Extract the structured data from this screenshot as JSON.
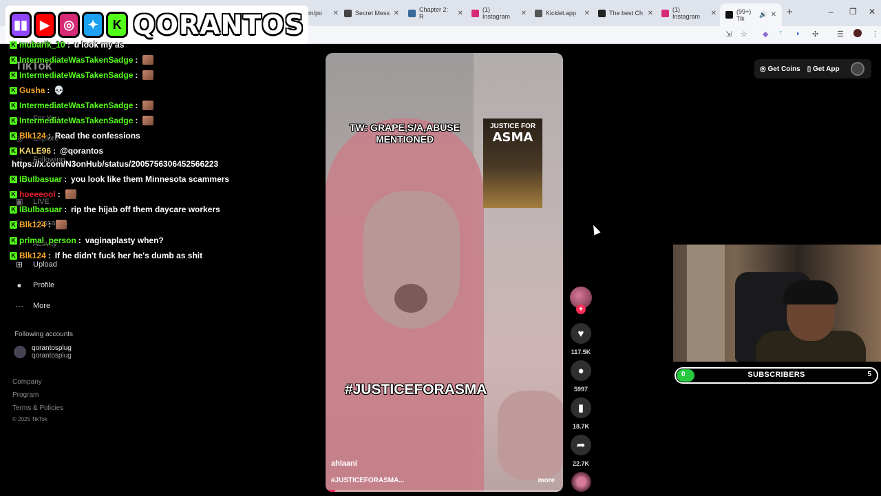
{
  "browser": {
    "tabs": [
      {
        "label": "m/po",
        "color": "#888888"
      },
      {
        "label": "Secret Mess",
        "color": "#444444"
      },
      {
        "label": "Chapter 2: R",
        "color": "#3a6b9a"
      },
      {
        "label": "(1) Instagram",
        "color": "#d62976"
      },
      {
        "label": "Kicklet.app",
        "color": "#555555"
      },
      {
        "label": "The best Ch",
        "color": "#222222"
      },
      {
        "label": "(1) Instagram",
        "color": "#d62976"
      },
      {
        "label": "(99+) Tik",
        "color": "#111111"
      }
    ],
    "new_tab": "+",
    "min": "–",
    "max": "❐",
    "close": "✕"
  },
  "banner": {
    "icons": [
      {
        "name": "twitch-icon",
        "glyph": "▮▮",
        "color": "#9146ff"
      },
      {
        "name": "youtube-icon",
        "glyph": "▶",
        "color": "#ff0000"
      },
      {
        "name": "instagram-icon",
        "glyph": "◎",
        "color": "#d62976"
      },
      {
        "name": "twitter-icon",
        "glyph": "✦",
        "color": "#1da1f2"
      },
      {
        "name": "kick-icon",
        "glyph": "K",
        "color": "#53fc18"
      }
    ],
    "channel_name": "QORANTOS"
  },
  "tiktok": {
    "logo": "TikTok",
    "nav": [
      {
        "icon": "⌂",
        "label": "For You"
      },
      {
        "icon": "◎",
        "label": "Explore"
      },
      {
        "icon": "☺",
        "label": "Following"
      },
      {
        "icon": "▣",
        "label": "LIVE"
      },
      {
        "icon": "▽",
        "label": "Messages"
      },
      {
        "icon": "◔",
        "label": "Activity"
      },
      {
        "icon": "+",
        "label": "Upload"
      },
      {
        "icon": "●",
        "label": "Profile"
      },
      {
        "icon": "···",
        "label": "More"
      }
    ],
    "following_header": "Following accounts",
    "following_account": {
      "display": "qorantosplug",
      "handle": "qorantosplug"
    },
    "footer": [
      "Company",
      "Program",
      "Terms & Policies",
      "© 2025 TikTok"
    ],
    "top_right": {
      "coins": "Get Coins",
      "app": "Get App"
    }
  },
  "chat": [
    {
      "user": "mubarik_10",
      "color": "#53fc18",
      "msg": "u look my as",
      "emote": false
    },
    {
      "user": "IntermediateWasTakenSadge",
      "color": "#53fc18",
      "msg": "",
      "emote": true
    },
    {
      "user": "IntermediateWasTakenSadge",
      "color": "#53fc18",
      "msg": "",
      "emote": true
    },
    {
      "user": "Gusha",
      "color": "#f5a623",
      "msg": "💀",
      "emote": false
    },
    {
      "user": "IntermediateWasTakenSadge",
      "color": "#53fc18",
      "msg": "",
      "emote": true
    },
    {
      "user": "IntermediateWasTakenSadge",
      "color": "#53fc18",
      "msg": "",
      "emote": true
    },
    {
      "user": "Blk124",
      "color": "#f5a623",
      "msg": "Read the confessions",
      "emote": false
    },
    {
      "user": "KALE96",
      "color": "#f5d76e",
      "msg": "@qorantos",
      "emote": false
    },
    {
      "user": "",
      "color": "#ffffff",
      "msg": "https://x.com/N3onHub/status/2005756306452566223",
      "emote": false
    },
    {
      "user": "IBulbasuar",
      "color": "#53fc18",
      "msg": "you look like them Minnesota scammers",
      "emote": false
    },
    {
      "user": "hoeeeool",
      "color": "#e2202b",
      "msg": "",
      "emote": true
    },
    {
      "user": "IBulbasuar",
      "color": "#53fc18",
      "msg": "rip the hijab off them daycare workers",
      "emote": false
    },
    {
      "user": "Blk124",
      "color": "#f5a623",
      "msg": "",
      "emote": true
    },
    {
      "user": "primal_person",
      "color": "#53fc18",
      "msg": "vaginaplasty when?",
      "emote": false
    },
    {
      "user": "Blk124",
      "color": "#f5a623",
      "msg": "If he didn't fuck her he's dumb as shit",
      "emote": false
    }
  ],
  "video": {
    "caption_top": "TW: GRAPE,S/A,ABUSE MENTIONED",
    "poster_line1": "JUSTICE FOR",
    "poster_line2": "ASMA",
    "hashtag_overlay": "#JUSTICEFORASMA",
    "username": "ahlaani",
    "description": "#JUSTICEFORASMA...",
    "more": "more",
    "progress": 0.04
  },
  "actions": {
    "likes": "117.5K",
    "comments": "5997",
    "saves": "18.7K",
    "shares": "22.7K"
  },
  "subs": {
    "current": "0",
    "label": "SUBSCRIBERS",
    "goal": "5",
    "progress": 0.0
  }
}
